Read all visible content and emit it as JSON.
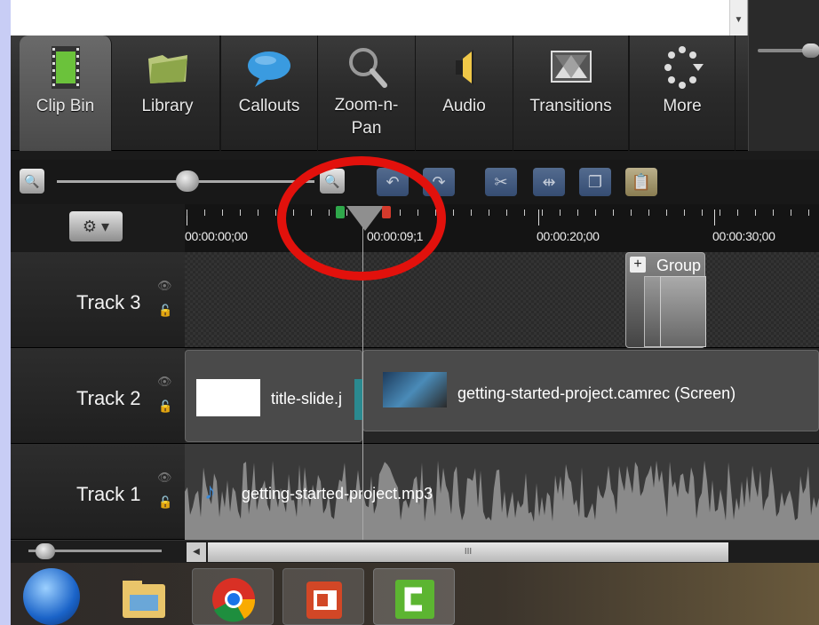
{
  "toolbar": {
    "items": [
      {
        "label": "Clip Bin",
        "icon": "film-strip-icon"
      },
      {
        "label": "Library",
        "icon": "folder-icon"
      },
      {
        "label": "Callouts",
        "icon": "speech-bubble-icon"
      },
      {
        "label": "Zoom-n-\nPan",
        "icon": "magnifier-icon"
      },
      {
        "label": "Audio",
        "icon": "speaker-icon"
      },
      {
        "label": "Transitions",
        "icon": "transitions-icon"
      },
      {
        "label": "More",
        "icon": "more-icon"
      }
    ]
  },
  "ruler": {
    "labels": [
      "00:00:00;00",
      "00:00:09;1",
      "00:00:20;00",
      "00:00:30;00"
    ]
  },
  "tracks": [
    {
      "name": "Track 3",
      "clip": "Group"
    },
    {
      "name": "Track 2",
      "clips": [
        "title-slide.j",
        "getting-started-project.camrec (Screen)"
      ]
    },
    {
      "name": "Track 1",
      "clip": "getting-started-project.mp3"
    }
  ],
  "group_label": "Group",
  "scroll_mark": "III",
  "colors": {
    "annotation_circle": "#e2110c",
    "playhead_green": "#2fa84b",
    "playhead_red": "#d43a2c"
  }
}
